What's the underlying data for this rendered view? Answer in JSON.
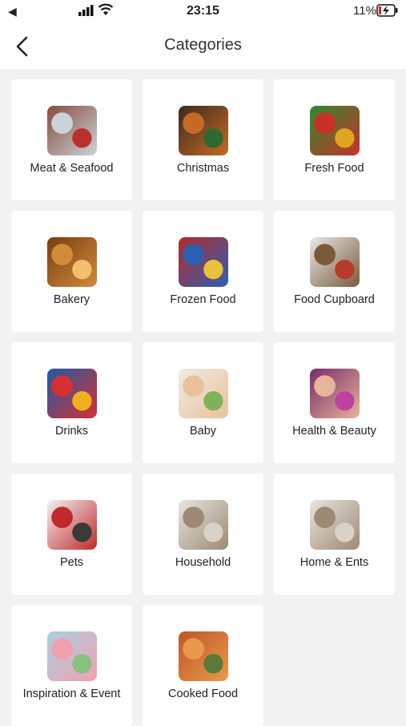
{
  "status": {
    "time": "23:15",
    "battery": "11%"
  },
  "header": {
    "title": "Categories"
  },
  "categories": [
    {
      "label": "Meat & Seafood",
      "icon": "meat-seafood-image",
      "colors": [
        "#8b4a3a",
        "#c9d4da",
        "#b9312b"
      ]
    },
    {
      "label": "Christmas",
      "icon": "christmas-image",
      "colors": [
        "#3b2a20",
        "#c56a25",
        "#2e6a2f"
      ]
    },
    {
      "label": "Fresh Food",
      "icon": "fresh-food-image",
      "colors": [
        "#2f8a2f",
        "#c9302a",
        "#e3a51d"
      ]
    },
    {
      "label": "Bakery",
      "icon": "bakery-image",
      "colors": [
        "#7a3c12",
        "#d28b3a",
        "#f0c070"
      ]
    },
    {
      "label": "Frozen Food",
      "icon": "frozen-food-image",
      "colors": [
        "#b52a2a",
        "#2d5fb0",
        "#e7c23b"
      ]
    },
    {
      "label": "Food Cupboard",
      "icon": "food-cupboard-image",
      "colors": [
        "#e8e8e8",
        "#7a5a3a",
        "#b83a2a"
      ]
    },
    {
      "label": "Drinks",
      "icon": "drinks-image",
      "colors": [
        "#1f5aa8",
        "#d63030",
        "#f0b020"
      ]
    },
    {
      "label": "Baby",
      "icon": "baby-image",
      "colors": [
        "#f0ebe5",
        "#e9c29a",
        "#7fb35a"
      ]
    },
    {
      "label": "Health & Beauty",
      "icon": "health-beauty-image",
      "colors": [
        "#7a2a6a",
        "#e6b59a",
        "#c040a0"
      ]
    },
    {
      "label": "Pets",
      "icon": "pets-image",
      "colors": [
        "#f2f2f2",
        "#c02a2a",
        "#3a3a3a"
      ]
    },
    {
      "label": "Household",
      "icon": "household-image",
      "colors": [
        "#e8e4de",
        "#9c8a74",
        "#d9d2c8"
      ]
    },
    {
      "label": "Home & Ents",
      "icon": "home-ents-image",
      "colors": [
        "#e8e4de",
        "#9c8a74",
        "#d9d2c8"
      ]
    },
    {
      "label": "Inspiration & Event",
      "icon": "inspiration-event-image",
      "colors": [
        "#a8d0e0",
        "#f2a0b0",
        "#8ac080"
      ]
    },
    {
      "label": "Cooked Food",
      "icon": "cooked-food-image",
      "colors": [
        "#c0552a",
        "#e89a4a",
        "#5a7a3a"
      ]
    }
  ]
}
